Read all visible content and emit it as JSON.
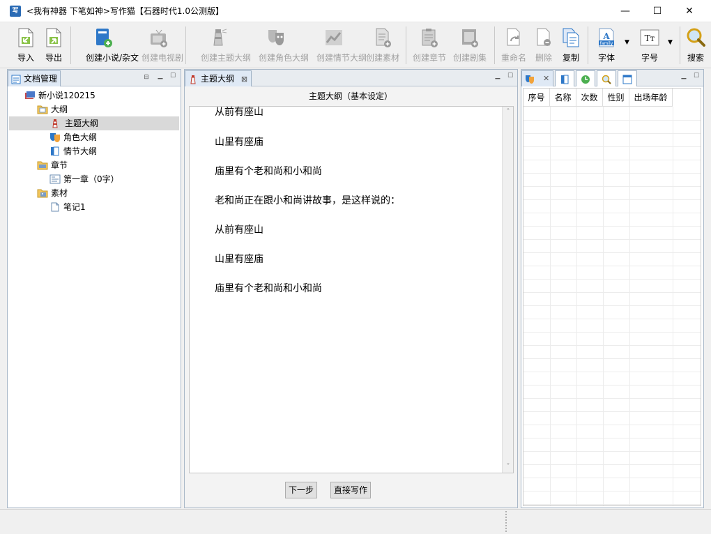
{
  "window": {
    "app_icon_text": "写",
    "title": "<我有神器 下笔如神>写作猫【石器时代1.0公测版】",
    "minimize": "—",
    "maximize": "☐",
    "close": "✕"
  },
  "toolbar": {
    "import": "导入",
    "export": "导出",
    "create_novel": "创建小说/杂文",
    "create_tv": "创建电视剧",
    "create_theme_outline": "创建主题大纲",
    "create_role_outline": "创建角色大纲",
    "create_plot_outline": "创建情节大纲",
    "create_material": "创建素材",
    "create_chapter": "创建章节",
    "create_episode": "创建剧集",
    "rename": "重命名",
    "delete": "删除",
    "copy": "复制",
    "font": "字体",
    "font_icon_text": "family",
    "font_size": "字号",
    "font_size_icon_text": "Tт",
    "search": "搜索"
  },
  "doc_manager": {
    "tab_label": "文档管理",
    "tree": [
      {
        "label": "新小说120215",
        "icon": "book-icon"
      },
      {
        "label": "大纲",
        "icon": "folder-icon"
      },
      {
        "label": "主题大纲",
        "icon": "lighthouse-icon",
        "selected": true
      },
      {
        "label": "角色大纲",
        "icon": "masks-icon"
      },
      {
        "label": "情节大纲",
        "icon": "book-page-icon"
      },
      {
        "label": "章节",
        "icon": "folder-box-icon"
      },
      {
        "label": "第一章（0字）",
        "icon": "chapter-doc-icon"
      },
      {
        "label": "素材",
        "icon": "folder-photo-icon"
      },
      {
        "label": "笔记1",
        "icon": "note-icon"
      }
    ]
  },
  "editor": {
    "tab_label": "主题大纲",
    "tab_close": "⊠",
    "header": "主题大纲（基本设定）",
    "paragraphs": [
      "从前有座山",
      "山里有座庙",
      "庙里有个老和尚和小和尚",
      "老和尚正在跟小和尚讲故事，是这样说的：",
      "从前有座山",
      "山里有座庙",
      "庙里有个老和尚和小和尚"
    ],
    "next_button": "下一步",
    "direct_write_button": "直接写作"
  },
  "character_panel": {
    "close_glyph": "✕",
    "columns": [
      "序号",
      "名称",
      "次数",
      "性别",
      "出场年龄"
    ]
  },
  "colors": {
    "title_bg": "#ffffff",
    "toolbar_bg": "#f0f0f0",
    "selected_row": "#d9d9d9",
    "disabled_text": "#a0a0a0",
    "pane_border": "#a9b8c8"
  }
}
